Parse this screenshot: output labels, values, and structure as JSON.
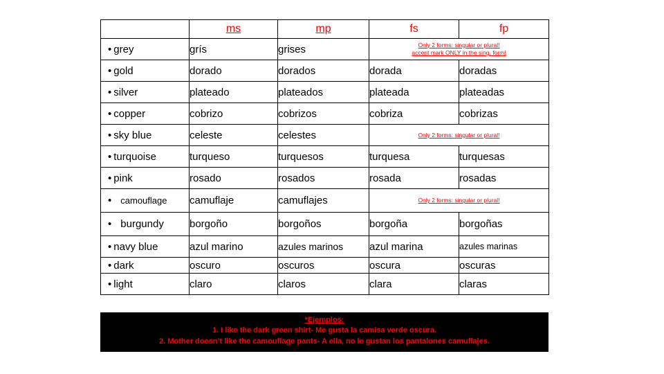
{
  "table": {
    "headers": [
      "",
      "ms",
      "mp",
      "fs",
      "fp"
    ],
    "notes": {
      "two_forms_long": "Only 2 forms: singular or plural! accent mark ONLY in the sing. form!",
      "two_forms_long_line1": "Only 2 forms: singular or plural!",
      "two_forms_long_line2": "accent mark ONLY in the sing. form!",
      "two_forms": "Only 2 forms: singular or plural!"
    },
    "rows": [
      {
        "english": "grey",
        "bullet": "•",
        "ms": "grís",
        "mp": "grises",
        "fs": "NOTE_LONG",
        "fp": ""
      },
      {
        "english": "gold",
        "bullet": "•",
        "ms": "dorado",
        "mp": "dorados",
        "fs": "dorada",
        "fp": "doradas"
      },
      {
        "english": "silver",
        "bullet": "•",
        "ms": "plateado",
        "mp": "plateados",
        "fs": "plateada",
        "fp": "plateadas"
      },
      {
        "english": "copper",
        "bullet": "•",
        "ms": "cobrizo",
        "mp": "cobrizos",
        "fs": "cobriza",
        "fp": "cobrizas"
      },
      {
        "english": "sky blue",
        "bullet": "•",
        "ms": "celeste",
        "mp": "celestes",
        "fs": "NOTE",
        "fp": ""
      },
      {
        "english": "turquoise",
        "bullet": "•",
        "ms": "turqueso",
        "mp": "turquesos",
        "fs": "turquesa",
        "fp": "turquesas"
      },
      {
        "english": "pink",
        "bullet": "•",
        "ms": "rosado",
        "mp": "rosados",
        "fs": "rosada",
        "fp": "rosadas"
      },
      {
        "english": "camouflage",
        "bullet": "•",
        "ms": "camuflaje",
        "mp": "camuflajes",
        "fs": "NOTE",
        "fp": ""
      },
      {
        "english": "burgundy",
        "bullet": "•",
        "ms": "borgoño",
        "mp": "borgoños",
        "fs": "borgoña",
        "fp": "borgoñas"
      },
      {
        "english": "navy blue",
        "bullet": "•",
        "ms": "azul marino",
        "mp": "azules marinos",
        "fs": "azul marina",
        "fp": "azules marinas"
      },
      {
        "english": "dark",
        "bullet": "•",
        "ms": "oscuro",
        "mp": "oscuros",
        "fs": "oscura",
        "fp": "oscuras"
      },
      {
        "english": "light",
        "bullet": "•",
        "ms": "claro",
        "mp": "claros",
        "fs": "clara",
        "fp": "claras"
      }
    ]
  },
  "footer": {
    "title": "*Ejemplos:",
    "line1": "1. I like the dark green shirt- Me gusta la camisa verde oscura.",
    "line2": "2. Mother doesn’t like the camouflage pants- A ella, no le gustan los pantalones camuflajes."
  },
  "colors": {
    "accent": "#ff0000",
    "note_bg": "#000000",
    "text": "#000000",
    "background": "#ffffff"
  }
}
